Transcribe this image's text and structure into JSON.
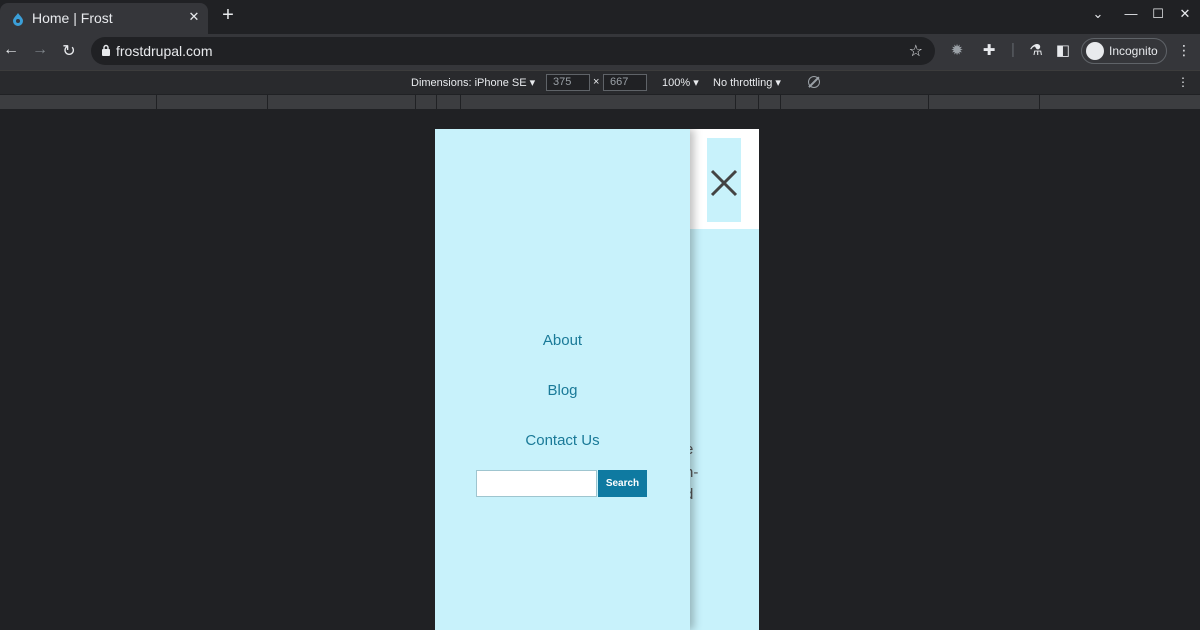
{
  "browser": {
    "tab_title": "Home | Frost",
    "tab_close": "✕",
    "new_tab": "+",
    "url": "frostdrupal.com",
    "incognito_label": "Incognito",
    "window_controls": {
      "tabs_menu": "⌄",
      "minimize": "—",
      "maximize": "☐",
      "close": "✕"
    },
    "nav": {
      "back": "←",
      "forward": "→",
      "reload": "↻"
    },
    "toolbar_icons": {
      "star": "☆",
      "extension_a": "✹",
      "extensions": "✚",
      "labs": "⚗",
      "side_panel": "◧",
      "menu": "⋮"
    }
  },
  "devtools": {
    "dimensions_label": "Dimensions: iPhone SE ▾",
    "width": "375",
    "times": "×",
    "height": "667",
    "zoom": "100% ▾",
    "throttling": "No throttling ▾",
    "menu": "⋮"
  },
  "page": {
    "menu_items": [
      {
        "label": "About"
      },
      {
        "label": "Blog"
      },
      {
        "label": "Contact Us"
      }
    ],
    "search_button": "Search",
    "search_placeholder": "",
    "background_text_fragments": [
      "e",
      "h-",
      "d",
      "t"
    ]
  },
  "colors": {
    "page_bg": "#c8f2fb",
    "link": "#1a7a98",
    "search_button": "#0f7aa1"
  }
}
